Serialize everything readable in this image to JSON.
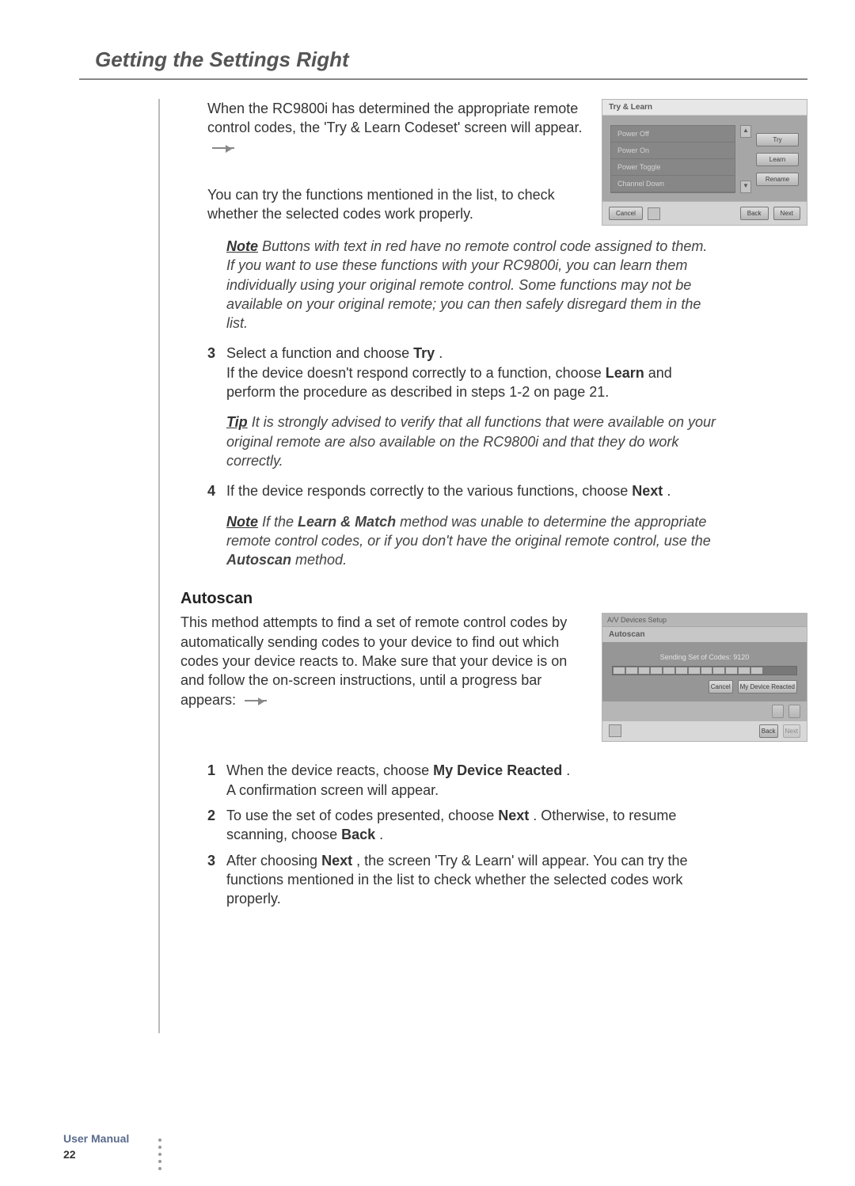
{
  "chapter_title": "Getting the Settings Right",
  "intro": {
    "p1": "When the RC9800i has determined the appropriate remote control codes, the 'Try & Learn Codeset' screen will appear.",
    "p2": "You can try the functions mentioned in the list, to check whether the selected codes work properly."
  },
  "note1": {
    "label": "Note",
    "text": " Buttons with text in red have no remote control code assigned to them. If you want to use these functions with your RC9800i, you can learn them individually using your original remote control. Some functions may not be available on your original remote; you can then safely disregard them in the list."
  },
  "step3": {
    "no": "3",
    "lead": "Select a function and choose ",
    "bold1": "Try",
    "tail1": ".",
    "line2a": "If the device doesn't respond correctly to a function, choose ",
    "bold2": "Learn",
    "line2b": " and perform the procedure as described in steps 1-2 on page 21."
  },
  "tip1": {
    "label": "Tip",
    "text": " It is strongly advised to verify that all functions that were available on your original remote are also available on the RC9800i and that they do work correctly."
  },
  "step4": {
    "no": "4",
    "lead": "If the device responds correctly to the various functions, choose ",
    "bold1": "Next",
    "tail1": "."
  },
  "note2": {
    "label": "Note",
    "text_a": " If the ",
    "bold1": "Learn & Match",
    "text_b": " method was unable to determine the appropriate remote control codes, or if you don't have the original remote control, use the ",
    "bold2": "Autoscan",
    "text_c": " method."
  },
  "autoscan": {
    "heading": "Autoscan",
    "p1": "This method attempts to find a set of remote control codes by automatically sending codes to your device to find out which codes your device reacts to. Make sure that your device is on and follow the on-screen instructions, until a progress bar appears:"
  },
  "as_step1": {
    "no": "1",
    "lead": "When the device reacts, choose ",
    "bold1": "My Device Reacted",
    "tail1": ".",
    "line2": "A confirmation screen will appear."
  },
  "as_step2": {
    "no": "2",
    "lead": "To use the set of codes presented, choose ",
    "bold1": "Next",
    "mid": ". Otherwise, to resume scanning, choose ",
    "bold2": "Back",
    "tail": "."
  },
  "as_step3": {
    "no": "3",
    "lead": "After choosing ",
    "bold1": "Next",
    "tail": ", the screen 'Try & Learn' will appear. You can try the functions mentioned in the list to check whether the selected codes work properly."
  },
  "device1": {
    "title": "Try & Learn",
    "items": [
      "Power Off",
      "Power On",
      "Power Toggle",
      "Channel Down"
    ],
    "btn_try": "Try",
    "btn_learn": "Learn",
    "btn_rename": "Rename",
    "btn_cancel": "Cancel",
    "btn_back": "Back",
    "btn_next": "Next"
  },
  "device2": {
    "titlebar": "A/V Devices Setup",
    "time": "",
    "sub": "Autoscan",
    "sending": "Sending Set of Codes: 9120",
    "btn_cancel": "Cancel",
    "btn_reacted": "My Device Reacted",
    "btn_back": "Back",
    "btn_next": "Next"
  },
  "footer": {
    "label": "User Manual",
    "page": "22"
  }
}
